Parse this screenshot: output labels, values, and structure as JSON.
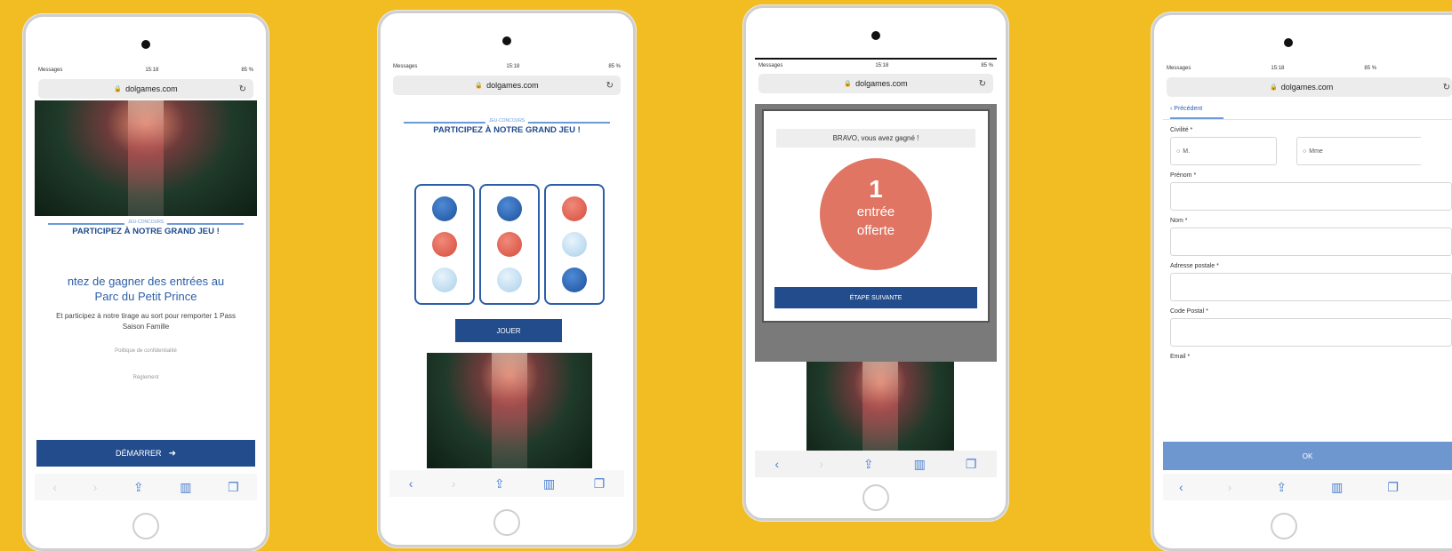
{
  "common": {
    "url": "dolgames.com",
    "carrier": "Messages",
    "time": "15:18",
    "battery": "85 %"
  },
  "phone1": {
    "divider_sub": "JEU-CONCOURS",
    "title": "PARTICIPEZ À NOTRE GRAND JEU !",
    "headline_line1": "ntez de gagner des entrées au",
    "headline_line2": "Parc du Petit Prince",
    "body": "Et participez à notre tirage au sort pour remporter 1 Pass Saison Famille",
    "privacy_link": "Politique de confidentialité",
    "rules_link": "Règlement",
    "start_button": "DÉMARRER"
  },
  "phone2": {
    "divider_sub": "JEU-CONCOURS",
    "title": "PARTICIPEZ À NOTRE GRAND JEU !",
    "play_button": "JOUER",
    "reels": [
      [
        "blue",
        "red",
        "light"
      ],
      [
        "blue",
        "red",
        "light"
      ],
      [
        "red",
        "light",
        "blue"
      ]
    ]
  },
  "phone3": {
    "win_message": "BRAVO, vous avez gagné !",
    "prize_number": "1",
    "prize_line1": "entrée",
    "prize_line2": "offerte",
    "next_button": "ÉTAPE SUIVANTE"
  },
  "phone4": {
    "back_link": "‹ Précédent",
    "civility_label": "Civilité *",
    "option_m": "M.",
    "option_mme": "Mme",
    "firstname_label": "Prénom *",
    "lastname_label": "Nom *",
    "address_label": "Adresse postale *",
    "postcode_label": "Code Postal *",
    "email_label": "Email *",
    "ok_button": "OK"
  },
  "colors": {
    "background": "#F2BD22",
    "brand_blue": "#234c8c",
    "prize_red": "#e07563"
  }
}
